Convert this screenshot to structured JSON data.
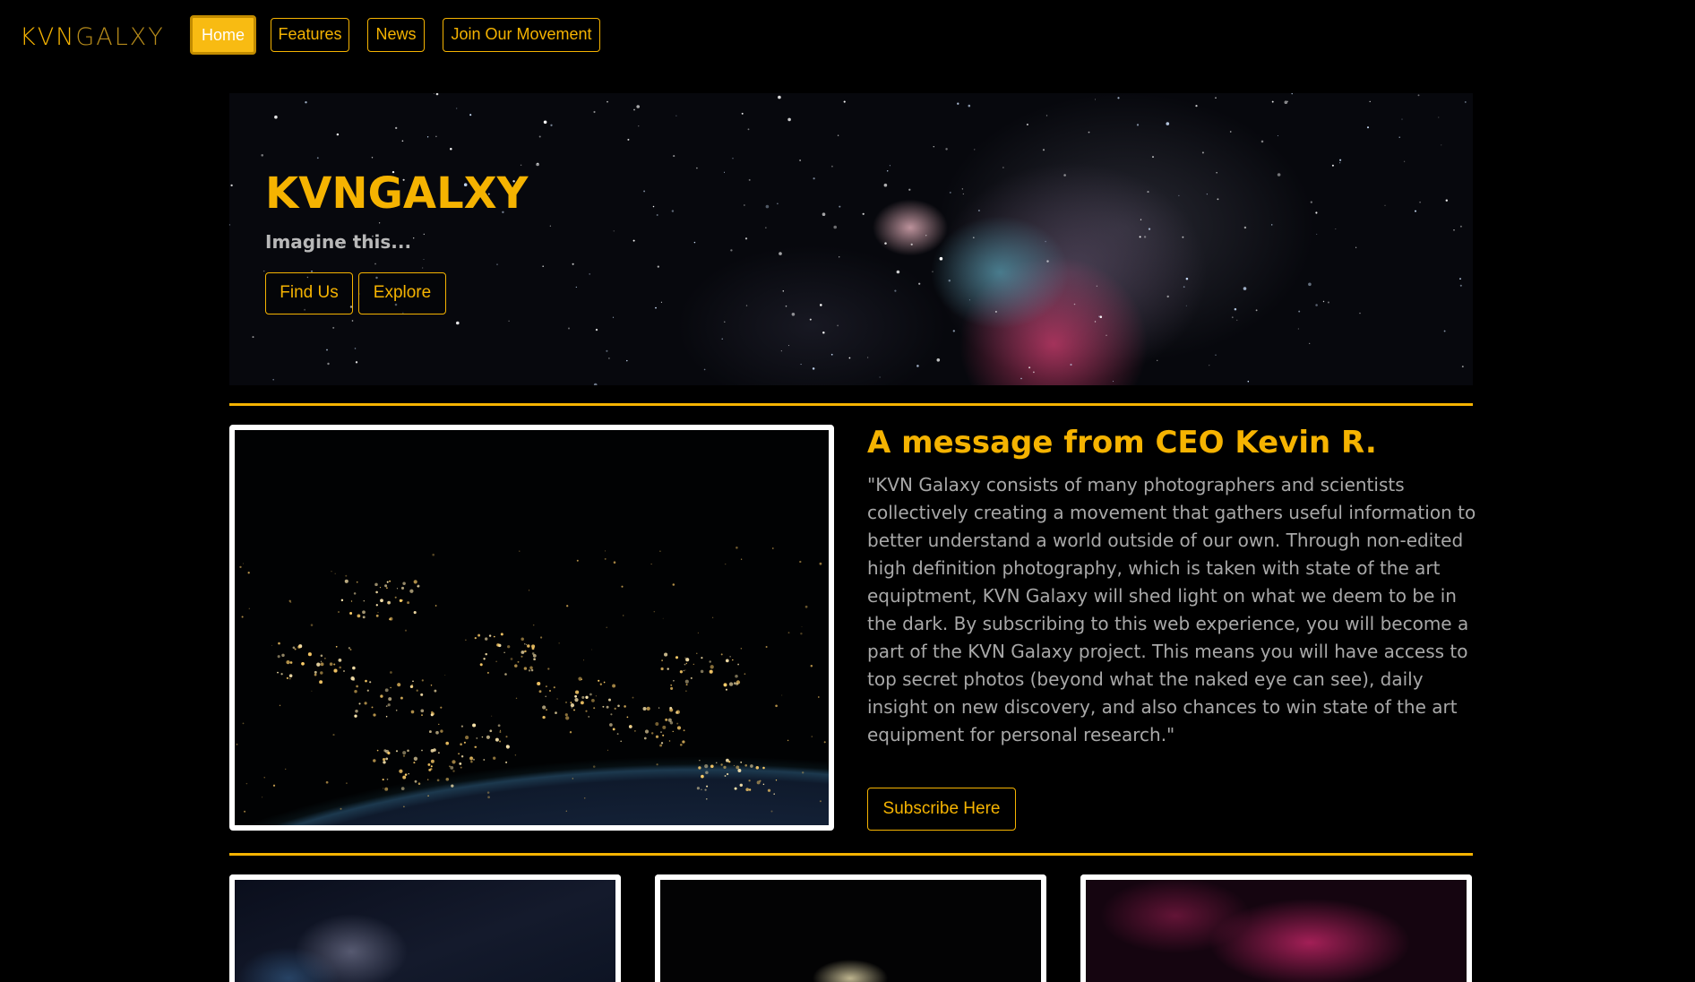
{
  "nav": {
    "brand_accent": "KVN",
    "brand_rest": "GALXY",
    "items": [
      {
        "label": "Home",
        "active": true
      },
      {
        "label": "Features",
        "active": false
      },
      {
        "label": "News",
        "active": false
      },
      {
        "label": "Join Our Movement",
        "active": false
      }
    ]
  },
  "hero": {
    "title": "KVNGALXY",
    "subtitle": "Imagine this...",
    "buttons": [
      {
        "label": "Find Us"
      },
      {
        "label": "Explore"
      }
    ]
  },
  "ceo": {
    "title": "A message from CEO Kevin R.",
    "message": "\"KVN Galaxy consists of many photographers and scientists collectively creating a movement that gathers useful information to better understand a world outside of our own. Through non-edited high definition photography, which is taken with state of the art equiptment, KVN Galaxy will shed light on what we deem to be in the dark. By subscribing to this web experience, you will become a part of the KVN Galaxy project. This means you will have access to top secret photos (beyond what the naked eye can see), daily insight on new discovery, and also chances to win state of the art equipment for personal research.\"",
    "subscribe_label": "Subscribe Here"
  },
  "colors": {
    "accent": "#f5b301",
    "background": "#000000",
    "body_text": "#a8a8a8",
    "frame": "#ffffff"
  }
}
